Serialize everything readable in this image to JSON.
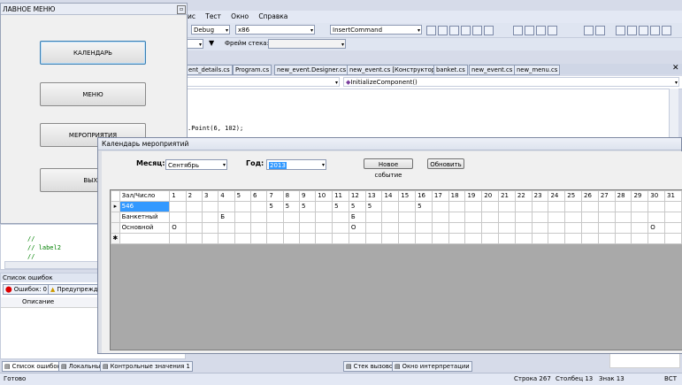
{
  "vs": {
    "menu": [
      "ис",
      "Тест",
      "Окно",
      "Справка"
    ],
    "config_combo": "Debug",
    "platform_combo": "x86",
    "find_combo": "InsertCommand",
    "stack_label": "Фрейм стека:",
    "doc_tabs": [
      "ent_details.cs",
      "Program.cs",
      "new_event.Designer.cs",
      "new_event.cs [Конструктор]",
      "banket.cs",
      "new_event.cs",
      "new_menu.cs"
    ],
    "member_combo": "InitializeComponent()",
    "code_line": ".Point(6, 102);",
    "code_panel_lines": [
      "//",
      "// label2",
      "//"
    ]
  },
  "menu_window": {
    "title": "ЛАВНОЕ МЕНЮ",
    "buttons": [
      "КАЛЕНДАРЬ",
      "МЕНЮ",
      "МЕРОПРИЯТИЯ",
      "ВЫХО"
    ]
  },
  "error_panel": {
    "title": "Список ошибок",
    "errors_btn": "Ошибок: 0",
    "warnings_btn": "Предупрежде",
    "column": "Описание"
  },
  "bottom_tabs": [
    "Список ошибок",
    "Локальные",
    "Контрольные значения 1",
    "Стек вызовов",
    "Окно интерпретации"
  ],
  "status": {
    "ready": "Готово",
    "line": "Строка 267",
    "col": "Столбец 13",
    "ch": "Знак 13",
    "ins": "ВСТ"
  },
  "calendar": {
    "title": "Календарь мероприятий",
    "month_label": "Месяц:",
    "month_value": "Сентябрь",
    "year_label": "Год:",
    "year_value": "2013",
    "new_event_btn": "Новое событие",
    "refresh_btn": "Обновить",
    "grid_header": "Зал/Число",
    "days": [
      "1",
      "2",
      "3",
      "4",
      "5",
      "6",
      "7",
      "8",
      "9",
      "10",
      "11",
      "12",
      "13",
      "14",
      "15",
      "16",
      "17",
      "18",
      "19",
      "20",
      "21",
      "22",
      "23",
      "24",
      "25",
      "26",
      "27",
      "28",
      "29",
      "30",
      "31"
    ],
    "rows": [
      {
        "marker": "▸",
        "name": "546",
        "cells": [
          "",
          "",
          "",
          "",
          "",
          "",
          "5",
          "5",
          "5",
          "",
          "5",
          "5",
          "5",
          "",
          "",
          "5",
          "",
          "",
          "",
          "",
          "",
          "",
          "",
          "",
          "",
          "",
          "",
          "",
          "",
          "",
          ""
        ]
      },
      {
        "marker": "",
        "name": "Банкетный",
        "cells": [
          "",
          "",
          "",
          "Б",
          "",
          "",
          "",
          "",
          "",
          "",
          "",
          "Б",
          "",
          "",
          "",
          "",
          "",
          "",
          "",
          "",
          "",
          "",
          "",
          "",
          "",
          "",
          "",
          "",
          "",
          "",
          ""
        ]
      },
      {
        "marker": "",
        "name": "Основной",
        "cells": [
          "О",
          "",
          "",
          "",
          "",
          "",
          "",
          "",
          "",
          "",
          "",
          "О",
          "",
          "",
          "",
          "",
          "",
          "",
          "",
          "",
          "",
          "",
          "",
          "",
          "",
          "",
          "",
          "",
          "",
          "О",
          ""
        ]
      },
      {
        "marker": "✱",
        "name": "",
        "cells": [
          "",
          "",
          "",
          "",
          "",
          "",
          "",
          "",
          "",
          "",
          "",
          "",
          "",
          "",
          "",
          "",
          "",
          "",
          "",
          "",
          "",
          "",
          "",
          "",
          "",
          "",
          "",
          "",
          "",
          "",
          ""
        ]
      }
    ]
  }
}
